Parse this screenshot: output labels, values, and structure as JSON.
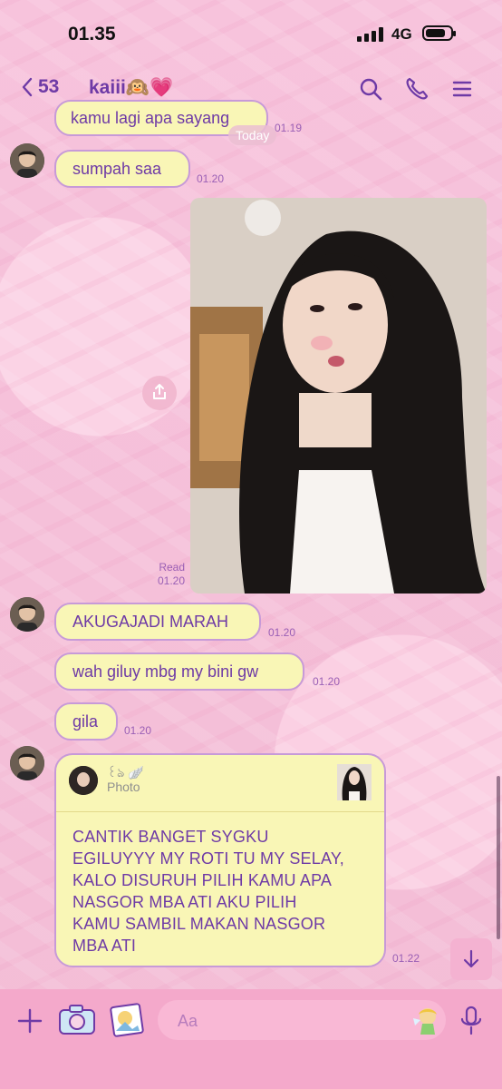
{
  "status": {
    "time": "01.35",
    "network": "4G"
  },
  "header": {
    "back_count": "53",
    "chat_name": "kaiii🙉💗"
  },
  "messages": [
    {
      "text": "kamu lagi apa sayang",
      "time": "01.19"
    },
    {
      "text": "sumpah saa",
      "time": "01.20"
    },
    {
      "read": "Read",
      "time": "01.20"
    },
    {
      "text": "AKUGAJADI MARAH",
      "time": "01.20"
    },
    {
      "text": "wah giluy mbg my bini gw",
      "time": "01.20"
    },
    {
      "text": "gila",
      "time": "01.20"
    }
  ],
  "date_chip": "Today",
  "reply": {
    "quoted_name": "꒰ঌ 🪽",
    "quoted_label": "Photo",
    "lines": [
      "CANTIK BANGET SYGKU",
      "EGILUYYY MY ROTI TU MY SELAY,",
      "KALO DISURUH PILIH KAMU APA",
      "NASGOR MBA ATI AKU PILIH",
      "KAMU SAMBIL MAKAN NASGOR",
      "MBA ATI"
    ],
    "time": "01.22"
  },
  "input": {
    "placeholder": "Aa"
  },
  "icons": {
    "back": "chevron-left-icon",
    "search": "search-icon",
    "call": "phone-icon",
    "menu": "menu-icon",
    "share": "share-icon",
    "add": "plus-icon",
    "camera": "camera-icon",
    "gallery": "gallery-icon",
    "sticker": "sticker-icon",
    "mic": "microphone-icon",
    "scroll_down": "arrow-down-icon"
  },
  "colors": {
    "accent": "#6e3aa6",
    "bubble": "#f9f6b6",
    "bubble_border": "#c79ad8",
    "background": "#f6c6dc"
  }
}
